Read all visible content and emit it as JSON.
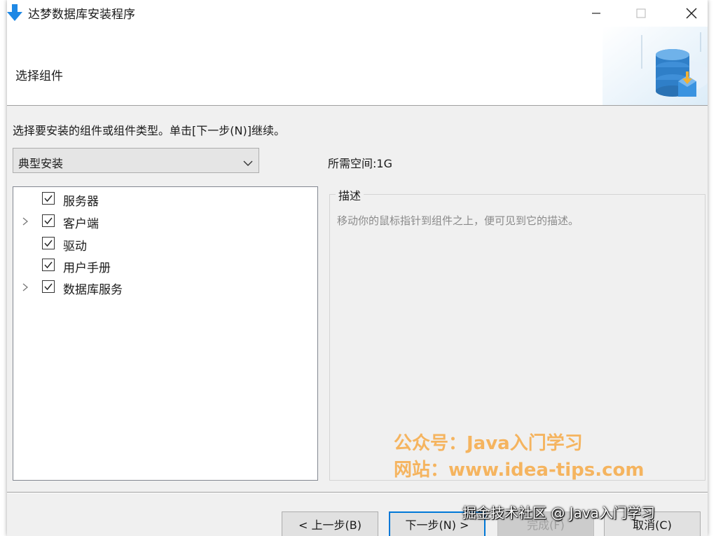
{
  "window": {
    "title": "达梦数据库安装程序",
    "controls": {
      "minimize_icon": "minimize-icon",
      "maximize_icon": "maximize-icon",
      "close_icon": "close-icon"
    }
  },
  "header": {
    "step_title": "选择组件",
    "graphic_icon": "database-install-icon"
  },
  "body": {
    "instruction": "选择要安装的组件或组件类型。单击[下一步(N)]继续。",
    "install_type": {
      "selected": "典型安装"
    },
    "space_required": "所需空间:1G",
    "components": [
      {
        "label": "服务器",
        "checked": true,
        "expandable": false
      },
      {
        "label": "客户端",
        "checked": true,
        "expandable": true
      },
      {
        "label": "驱动",
        "checked": true,
        "expandable": false
      },
      {
        "label": "用户手册",
        "checked": true,
        "expandable": false
      },
      {
        "label": "数据库服务",
        "checked": true,
        "expandable": true
      }
    ],
    "description": {
      "legend": "描述",
      "text": "移动你的鼠标指针到组件之上，便可见到它的描述。"
    }
  },
  "watermark": {
    "line1": "公众号：Java入门学习",
    "line2": "网站：www.idea-tips.com"
  },
  "footer": {
    "back_label": "< 上一步(B)",
    "next_label": "下一步(N) >",
    "finish_label": "完成(F)",
    "cancel_label": "取消(C)",
    "credit": "掘金技术社区 @ Java入门学习"
  },
  "colors": {
    "accent": "#0078d7",
    "app_icon": "#1e88e5",
    "watermark": "#f5b45f",
    "window_bg": "#f0f0f0"
  }
}
